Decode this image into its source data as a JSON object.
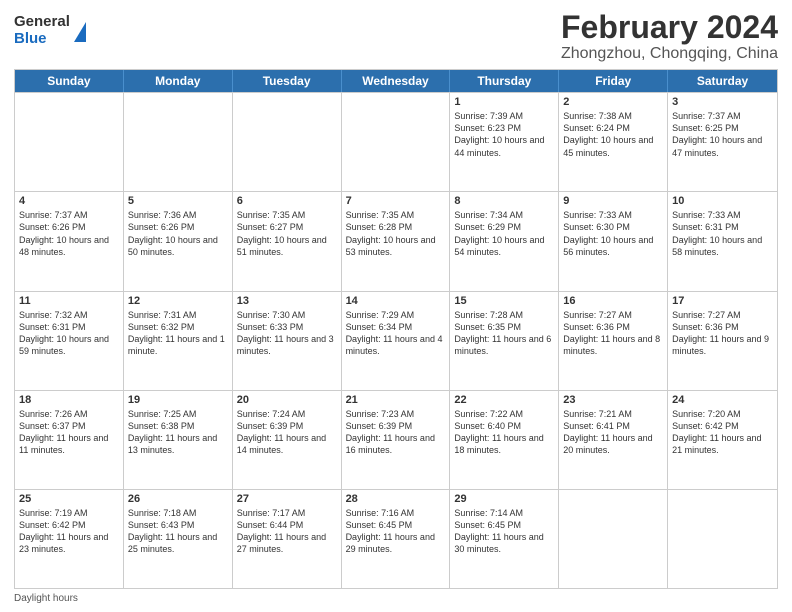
{
  "logo": {
    "general": "General",
    "blue": "Blue"
  },
  "title": "February 2024",
  "subtitle": "Zhongzhou, Chongqing, China",
  "days": [
    "Sunday",
    "Monday",
    "Tuesday",
    "Wednesday",
    "Thursday",
    "Friday",
    "Saturday"
  ],
  "weeks": [
    [
      {
        "day": "",
        "info": ""
      },
      {
        "day": "",
        "info": ""
      },
      {
        "day": "",
        "info": ""
      },
      {
        "day": "",
        "info": ""
      },
      {
        "day": "1",
        "info": "Sunrise: 7:39 AM\nSunset: 6:23 PM\nDaylight: 10 hours and 44 minutes."
      },
      {
        "day": "2",
        "info": "Sunrise: 7:38 AM\nSunset: 6:24 PM\nDaylight: 10 hours and 45 minutes."
      },
      {
        "day": "3",
        "info": "Sunrise: 7:37 AM\nSunset: 6:25 PM\nDaylight: 10 hours and 47 minutes."
      }
    ],
    [
      {
        "day": "4",
        "info": "Sunrise: 7:37 AM\nSunset: 6:26 PM\nDaylight: 10 hours and 48 minutes."
      },
      {
        "day": "5",
        "info": "Sunrise: 7:36 AM\nSunset: 6:26 PM\nDaylight: 10 hours and 50 minutes."
      },
      {
        "day": "6",
        "info": "Sunrise: 7:35 AM\nSunset: 6:27 PM\nDaylight: 10 hours and 51 minutes."
      },
      {
        "day": "7",
        "info": "Sunrise: 7:35 AM\nSunset: 6:28 PM\nDaylight: 10 hours and 53 minutes."
      },
      {
        "day": "8",
        "info": "Sunrise: 7:34 AM\nSunset: 6:29 PM\nDaylight: 10 hours and 54 minutes."
      },
      {
        "day": "9",
        "info": "Sunrise: 7:33 AM\nSunset: 6:30 PM\nDaylight: 10 hours and 56 minutes."
      },
      {
        "day": "10",
        "info": "Sunrise: 7:33 AM\nSunset: 6:31 PM\nDaylight: 10 hours and 58 minutes."
      }
    ],
    [
      {
        "day": "11",
        "info": "Sunrise: 7:32 AM\nSunset: 6:31 PM\nDaylight: 10 hours and 59 minutes."
      },
      {
        "day": "12",
        "info": "Sunrise: 7:31 AM\nSunset: 6:32 PM\nDaylight: 11 hours and 1 minute."
      },
      {
        "day": "13",
        "info": "Sunrise: 7:30 AM\nSunset: 6:33 PM\nDaylight: 11 hours and 3 minutes."
      },
      {
        "day": "14",
        "info": "Sunrise: 7:29 AM\nSunset: 6:34 PM\nDaylight: 11 hours and 4 minutes."
      },
      {
        "day": "15",
        "info": "Sunrise: 7:28 AM\nSunset: 6:35 PM\nDaylight: 11 hours and 6 minutes."
      },
      {
        "day": "16",
        "info": "Sunrise: 7:27 AM\nSunset: 6:36 PM\nDaylight: 11 hours and 8 minutes."
      },
      {
        "day": "17",
        "info": "Sunrise: 7:27 AM\nSunset: 6:36 PM\nDaylight: 11 hours and 9 minutes."
      }
    ],
    [
      {
        "day": "18",
        "info": "Sunrise: 7:26 AM\nSunset: 6:37 PM\nDaylight: 11 hours and 11 minutes."
      },
      {
        "day": "19",
        "info": "Sunrise: 7:25 AM\nSunset: 6:38 PM\nDaylight: 11 hours and 13 minutes."
      },
      {
        "day": "20",
        "info": "Sunrise: 7:24 AM\nSunset: 6:39 PM\nDaylight: 11 hours and 14 minutes."
      },
      {
        "day": "21",
        "info": "Sunrise: 7:23 AM\nSunset: 6:39 PM\nDaylight: 11 hours and 16 minutes."
      },
      {
        "day": "22",
        "info": "Sunrise: 7:22 AM\nSunset: 6:40 PM\nDaylight: 11 hours and 18 minutes."
      },
      {
        "day": "23",
        "info": "Sunrise: 7:21 AM\nSunset: 6:41 PM\nDaylight: 11 hours and 20 minutes."
      },
      {
        "day": "24",
        "info": "Sunrise: 7:20 AM\nSunset: 6:42 PM\nDaylight: 11 hours and 21 minutes."
      }
    ],
    [
      {
        "day": "25",
        "info": "Sunrise: 7:19 AM\nSunset: 6:42 PM\nDaylight: 11 hours and 23 minutes."
      },
      {
        "day": "26",
        "info": "Sunrise: 7:18 AM\nSunset: 6:43 PM\nDaylight: 11 hours and 25 minutes."
      },
      {
        "day": "27",
        "info": "Sunrise: 7:17 AM\nSunset: 6:44 PM\nDaylight: 11 hours and 27 minutes."
      },
      {
        "day": "28",
        "info": "Sunrise: 7:16 AM\nSunset: 6:45 PM\nDaylight: 11 hours and 29 minutes."
      },
      {
        "day": "29",
        "info": "Sunrise: 7:14 AM\nSunset: 6:45 PM\nDaylight: 11 hours and 30 minutes."
      },
      {
        "day": "",
        "info": ""
      },
      {
        "day": "",
        "info": ""
      }
    ]
  ],
  "footer": "Daylight hours"
}
